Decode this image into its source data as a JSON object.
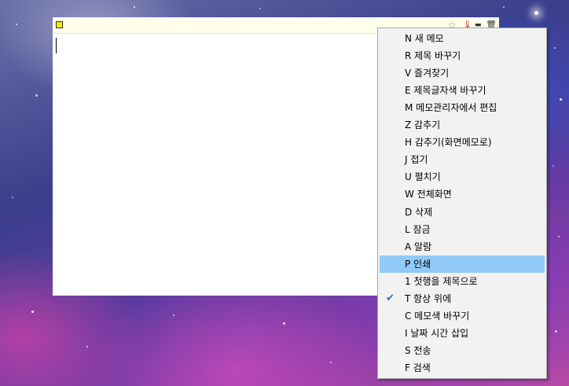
{
  "memo": {
    "titlebar_icons": {
      "star": "☆",
      "pin": "🌡",
      "minimize": "▬",
      "delete": "🗑"
    },
    "colors": {
      "titlebar_bg": "#ffffea",
      "swatch": "#f7ea00"
    }
  },
  "context_menu": {
    "highlight_color": "#91c9f7",
    "items": [
      {
        "label": "N 새 메모",
        "checked": false,
        "highlighted": false
      },
      {
        "label": "R 제목 바꾸기",
        "checked": false,
        "highlighted": false
      },
      {
        "label": "V 즐겨찾기",
        "checked": false,
        "highlighted": false
      },
      {
        "label": "E 제목글자색 바꾸기",
        "checked": false,
        "highlighted": false
      },
      {
        "label": "M 메모관리자에서 편집",
        "checked": false,
        "highlighted": false
      },
      {
        "label": "Z 감추기",
        "checked": false,
        "highlighted": false
      },
      {
        "label": "H 감추기(화면메모로)",
        "checked": false,
        "highlighted": false
      },
      {
        "label": "J 접기",
        "checked": false,
        "highlighted": false
      },
      {
        "label": "U 펼치기",
        "checked": false,
        "highlighted": false
      },
      {
        "label": "W 전체화면",
        "checked": false,
        "highlighted": false
      },
      {
        "label": "D 삭제",
        "checked": false,
        "highlighted": false
      },
      {
        "label": "L 잠금",
        "checked": false,
        "highlighted": false
      },
      {
        "label": "A 알람",
        "checked": false,
        "highlighted": false
      },
      {
        "label": "P 인쇄",
        "checked": false,
        "highlighted": true
      },
      {
        "label": "1 첫행을 제목으로",
        "checked": false,
        "highlighted": false
      },
      {
        "label": "T 항상 위에",
        "checked": true,
        "highlighted": false
      },
      {
        "label": "C 메모색 바꾸기",
        "checked": false,
        "highlighted": false
      },
      {
        "label": "I 날짜 시간 삽입",
        "checked": false,
        "highlighted": false
      },
      {
        "label": "S 전송",
        "checked": false,
        "highlighted": false
      },
      {
        "label": "F 검색",
        "checked": false,
        "highlighted": false
      }
    ],
    "check_glyph": "✔"
  }
}
